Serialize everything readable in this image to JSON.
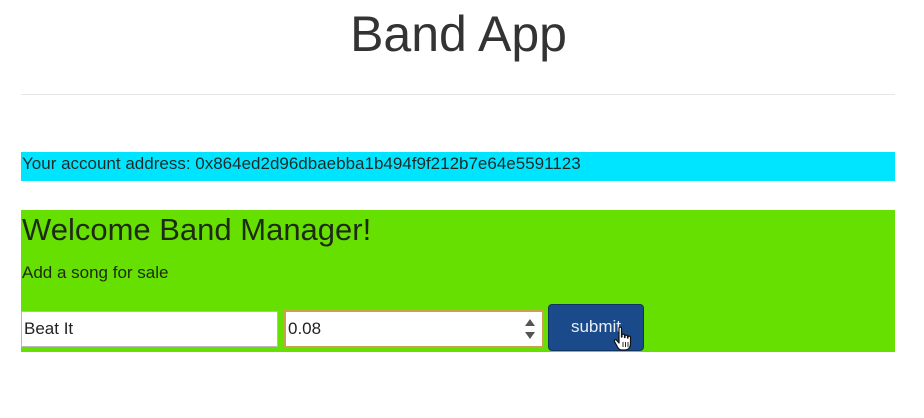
{
  "header": {
    "title": "Band App"
  },
  "account": {
    "text": "Your account address: 0x864ed2d96dbaebba1b494f9f212b7e64e5591123"
  },
  "manager_panel": {
    "heading": "Welcome Band Manager!",
    "subtitle": "Add a song for sale",
    "song_name_value": "Beat It",
    "price_value": "0.08",
    "submit_label": "submit"
  },
  "colors": {
    "account_bar_bg": "#00e5ff",
    "manager_panel_bg": "#66e000",
    "submit_button_bg": "#1a4a8a"
  },
  "icons": {
    "cursor": "hand-pointer-icon",
    "spinner_up": "spinner-up-icon",
    "spinner_down": "spinner-down-icon"
  }
}
